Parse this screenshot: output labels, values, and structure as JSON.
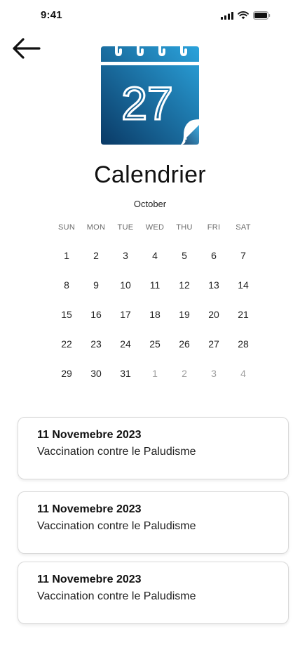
{
  "status_bar": {
    "time": "9:41",
    "icons": [
      "cellular-signal-icon",
      "wifi-icon",
      "battery-icon"
    ]
  },
  "header": {
    "back_icon": "back-arrow-icon",
    "calendar_icon_day": "27",
    "title": "Calendrier"
  },
  "calendar": {
    "month": "October",
    "weekdays": [
      "SUN",
      "MON",
      "TUE",
      "WED",
      "THU",
      "FRI",
      "SAT"
    ],
    "weeks": [
      [
        {
          "d": "1",
          "muted": false
        },
        {
          "d": "2",
          "muted": false
        },
        {
          "d": "3",
          "muted": false
        },
        {
          "d": "4",
          "muted": false
        },
        {
          "d": "5",
          "muted": false
        },
        {
          "d": "6",
          "muted": false
        },
        {
          "d": "7",
          "muted": false
        }
      ],
      [
        {
          "d": "8",
          "muted": false
        },
        {
          "d": "9",
          "muted": false
        },
        {
          "d": "10",
          "muted": false
        },
        {
          "d": "11",
          "muted": false
        },
        {
          "d": "12",
          "muted": false
        },
        {
          "d": "13",
          "muted": false
        },
        {
          "d": "14",
          "muted": false
        }
      ],
      [
        {
          "d": "15",
          "muted": false
        },
        {
          "d": "16",
          "muted": false
        },
        {
          "d": "17",
          "muted": false
        },
        {
          "d": "18",
          "muted": false
        },
        {
          "d": "19",
          "muted": false
        },
        {
          "d": "20",
          "muted": false
        },
        {
          "d": "21",
          "muted": false
        }
      ],
      [
        {
          "d": "22",
          "muted": false
        },
        {
          "d": "23",
          "muted": false
        },
        {
          "d": "24",
          "muted": false
        },
        {
          "d": "25",
          "muted": false
        },
        {
          "d": "26",
          "muted": false
        },
        {
          "d": "27",
          "muted": false
        },
        {
          "d": "28",
          "muted": false
        }
      ],
      [
        {
          "d": "29",
          "muted": false
        },
        {
          "d": "30",
          "muted": false
        },
        {
          "d": "31",
          "muted": false
        },
        {
          "d": "1",
          "muted": true
        },
        {
          "d": "2",
          "muted": true
        },
        {
          "d": "3",
          "muted": true
        },
        {
          "d": "4",
          "muted": true
        }
      ]
    ]
  },
  "events": [
    {
      "date": "11 Novemebre 2023",
      "title": "Vaccination contre le Paludisme"
    },
    {
      "date": "11 Novemebre 2023",
      "title": "Vaccination contre le Paludisme"
    },
    {
      "date": "11 Novemebre 2023",
      "title": "Vaccination contre le Paludisme"
    }
  ],
  "colors": {
    "icon_gradient_top": "#2ba3dc",
    "icon_gradient_bottom": "#0a3a66",
    "text": "#111111",
    "muted_text": "#9e9e9e",
    "card_border": "#d9d9d9"
  }
}
